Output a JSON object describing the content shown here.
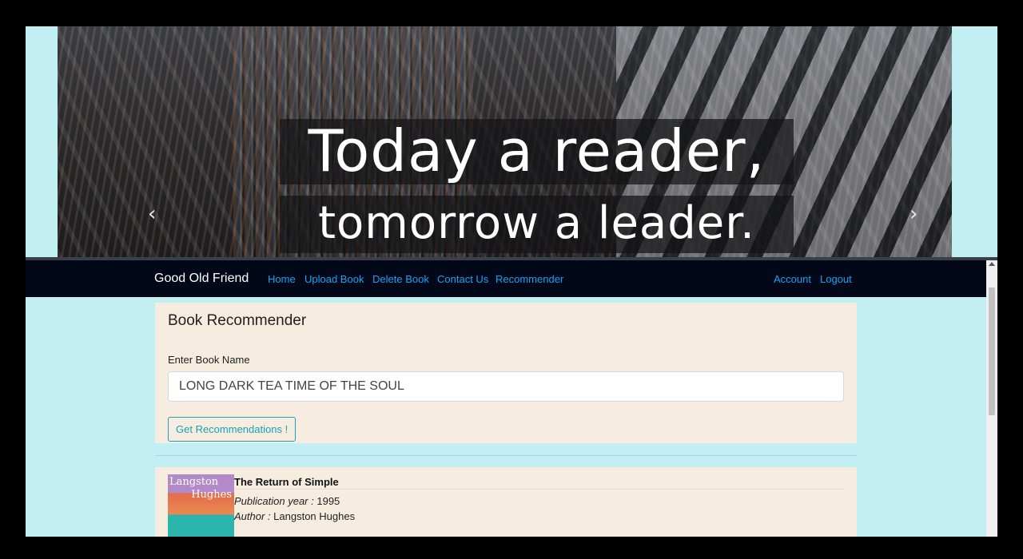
{
  "carousel": {
    "caption_line1": "Today a reader,",
    "caption_line2": "tomorrow a leader.",
    "prev_icon": "‹",
    "next_icon": "›"
  },
  "navbar": {
    "brand": "Good Old Friend",
    "links": [
      "Home",
      "Upload Book",
      "Delete Book",
      "Contact Us",
      "Recommender"
    ],
    "right_links": [
      "Account",
      "Logout"
    ]
  },
  "recommender": {
    "title": "Book Recommender",
    "field_label": "Enter Book Name",
    "input_value": "LONG DARK TEA TIME OF THE SOUL",
    "button_label": "Get Recommendations !"
  },
  "results": [
    {
      "title": "The Return of Simple",
      "year_label": "Publication year :",
      "year": "1995",
      "author_label": "Author :",
      "author": "Langston Hughes",
      "cover_text_line1": "Langston",
      "cover_text_line2": "Hughes"
    }
  ],
  "colors": {
    "page_bg": "#c2eff4",
    "navbar_bg": "#020818",
    "link": "#17a2f3",
    "card_bg": "#f6ece0",
    "button_accent": "#17a2b8"
  }
}
